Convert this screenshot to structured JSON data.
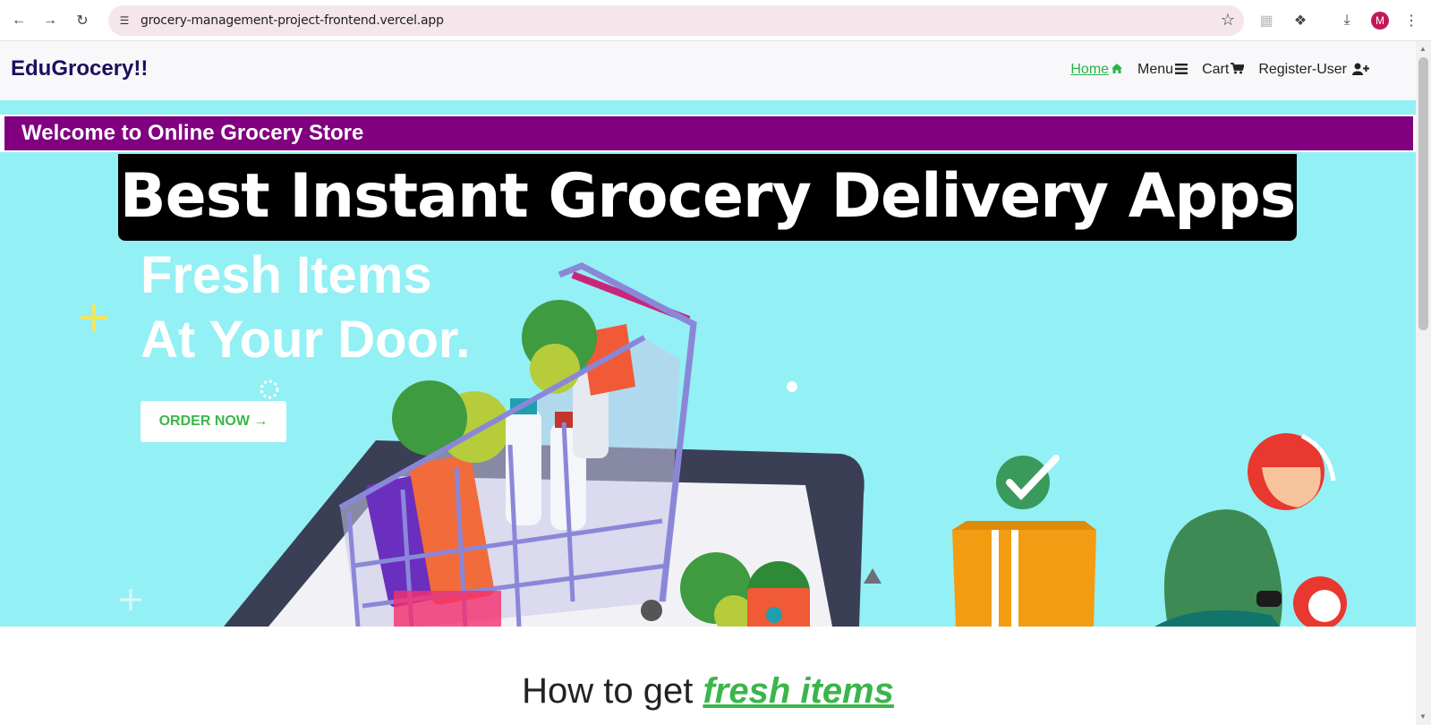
{
  "browser": {
    "url": "grocery-management-project-frontend.vercel.app",
    "profile_initial": "M",
    "icons": [
      "back-arrow",
      "forward-arrow",
      "reload",
      "site-info",
      "bookmark-star",
      "extension",
      "puzzle",
      "download",
      "more-vert"
    ]
  },
  "navbar": {
    "brand": "EduGrocery!!",
    "links": [
      {
        "label": "Home",
        "icon": "home-icon",
        "active": true
      },
      {
        "label": "Menu",
        "icon": "bars-icon",
        "active": false
      },
      {
        "label": "Cart",
        "icon": "cart-icon",
        "active": false
      },
      {
        "label": "Register-User",
        "icon": "user-plus-icon",
        "active": false
      }
    ]
  },
  "hero": {
    "welcome": "Welcome to Online Grocery Store",
    "banner": "Best Instant Grocery Delivery Apps",
    "headline_line1": "Fresh Items",
    "headline_line2": "At Your Door.",
    "cta": "ORDER NOW →"
  },
  "section": {
    "prefix": "How to get ",
    "highlight": "fresh items"
  },
  "colors": {
    "hero_bg": "#93f0f5",
    "welcome_bg": "#800080",
    "accent_green": "#3cb54b",
    "brand_text": "#1a0f5e"
  }
}
